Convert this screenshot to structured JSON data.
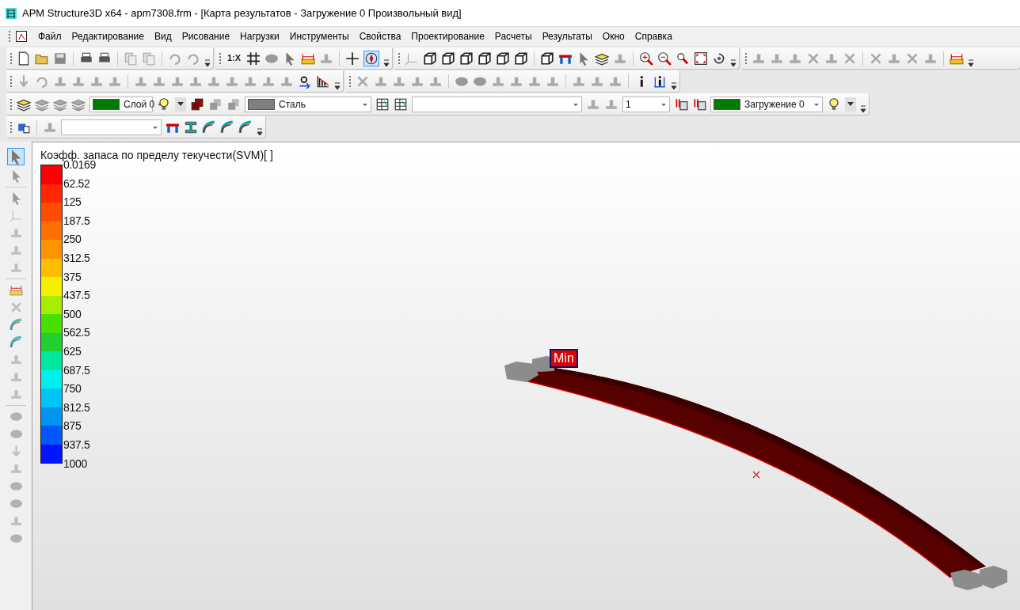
{
  "window": {
    "title": "APM Structure3D x64 - apm7308.frm - [Карта результатов - Загружение 0 Произвольный вид]"
  },
  "menu": [
    "Файл",
    "Редактирование",
    "Вид",
    "Рисование",
    "Нагрузки",
    "Инструменты",
    "Свойства",
    "Проектирование",
    "Расчеты",
    "Результаты",
    "Окно",
    "Справка"
  ],
  "toolbar": {
    "scale_button": "1:X",
    "snap_selected": true,
    "layer": {
      "value": "Слой 0",
      "color": "#007a00"
    },
    "material": {
      "value": "Сталь",
      "color": "#808080"
    },
    "count": {
      "value": "1"
    },
    "load_case": {
      "value": "Загружение 0",
      "color": "#007a00"
    }
  },
  "side_toolbar": {
    "first_selected": true
  },
  "legend": {
    "title": "Коэфф. запаса по пределу текучести(SVM)[ ]",
    "labels": [
      "0.0169",
      "62.52",
      "125",
      "187.5",
      "250",
      "312.5",
      "375",
      "437.5",
      "500",
      "562.5",
      "625",
      "687.5",
      "750",
      "812.5",
      "875",
      "937.5",
      "1000"
    ],
    "bands": [
      {
        "color": "#ff0000"
      },
      {
        "color": "#ff2600"
      },
      {
        "color": "#ff4c00"
      },
      {
        "color": "#ff7000"
      },
      {
        "color": "#ff9400"
      },
      {
        "color": "#ffbe00"
      },
      {
        "color": "#f4f000"
      },
      {
        "color": "#a8ec00"
      },
      {
        "color": "#48e000"
      },
      {
        "color": "#20d030"
      },
      {
        "color": "#00e8a0"
      },
      {
        "color": "#00f0f0"
      },
      {
        "color": "#00c4f8"
      },
      {
        "color": "#0094f0"
      },
      {
        "color": "#0058f8"
      },
      {
        "color": "#0014ff"
      }
    ]
  },
  "model": {
    "marker": "Min"
  }
}
